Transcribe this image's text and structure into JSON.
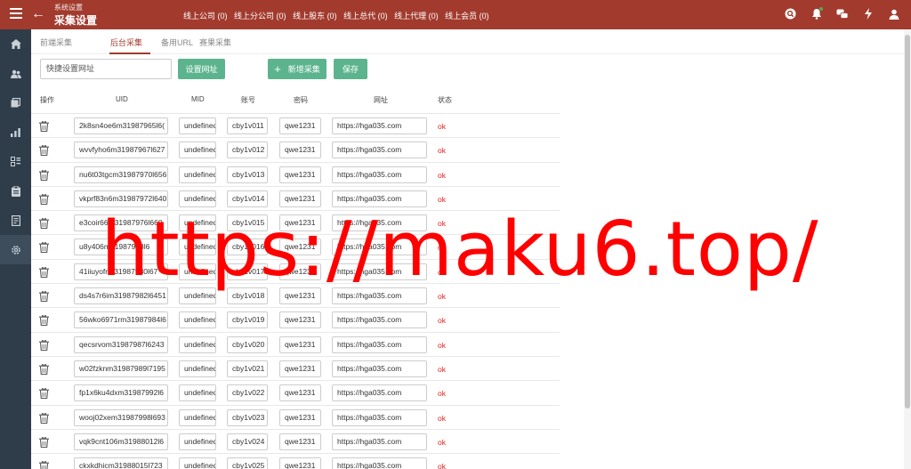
{
  "header": {
    "breadcrumb": "系统设置",
    "title": "采集设置",
    "back_glyph": "←",
    "stats": [
      "线上公司 (0)",
      "线上分公司 (0)",
      "线上股东 (0)",
      "线上总代 (0)",
      "线上代理 (0)",
      "线上会员 (0)"
    ]
  },
  "tabs": [
    "前端采集",
    "后台采集",
    "备用URL",
    "赛果采集"
  ],
  "toolbar": {
    "quick_input_placeholder": "快捷设置网址",
    "set_url_label": "设置网址",
    "add_label": "新增采集",
    "save_label": "保存"
  },
  "table": {
    "headers": [
      "操作",
      "UID",
      "MID",
      "账号",
      "密码",
      "网址",
      "状态"
    ],
    "rows": [
      {
        "uid": "2k8sn4oe6m31987965l6(",
        "mid": "undefined",
        "account": "cby1v011",
        "password": "qwe1231",
        "url": "https://hga035.com",
        "status": "ok"
      },
      {
        "uid": "wvvfyho6m31987967l627",
        "mid": "undefined",
        "account": "cby1v012",
        "password": "qwe1231",
        "url": "https://hga035.com",
        "status": "ok"
      },
      {
        "uid": "nu6t03tgcm31987970l656",
        "mid": "undefined",
        "account": "cby1v013",
        "password": "qwe1231",
        "url": "https://hga035.com",
        "status": "ok"
      },
      {
        "uid": "vkprf83n6m31987972l640",
        "mid": "undefined",
        "account": "cby1v014",
        "password": "qwe1231",
        "url": "https://hga035.com",
        "status": "ok"
      },
      {
        "uid": "e3coir66m31987976l660",
        "mid": "undefined",
        "account": "cby1v015",
        "password": "qwe1231",
        "url": "https://hga035.com",
        "status": "ok"
      },
      {
        "uid": "u8y406m31987978l6",
        "mid": "undefined",
        "account": "cby1v016",
        "password": "qwe1231",
        "url": "https://hga035.com",
        "status": "ok"
      },
      {
        "uid": "41iiuyofrm31987980l67",
        "mid": "undefined",
        "account": "cby1v017",
        "password": "qwe1231",
        "url": "https://hga035.com",
        "status": "ok"
      },
      {
        "uid": "ds4s7r6im31987982l6451",
        "mid": "undefined",
        "account": "cby1v018",
        "password": "qwe1231",
        "url": "https://hga035.com",
        "status": "ok"
      },
      {
        "uid": "56wko6971rm31987984l6",
        "mid": "undefined",
        "account": "cby1v019",
        "password": "qwe1231",
        "url": "https://hga035.com",
        "status": "ok"
      },
      {
        "uid": "qecsrvom31987987l6243",
        "mid": "undefined",
        "account": "cby1v020",
        "password": "qwe1231",
        "url": "https://hga035.com",
        "status": "ok"
      },
      {
        "uid": "w02fzknm31987989l7195",
        "mid": "undefined",
        "account": "cby1v021",
        "password": "qwe1231",
        "url": "https://hga035.com",
        "status": "ok"
      },
      {
        "uid": "fp1x6ku4dxm31987992l6",
        "mid": "undefined",
        "account": "cby1v022",
        "password": "qwe1231",
        "url": "https://hga035.com",
        "status": "ok"
      },
      {
        "uid": "wooj02xem31987998l693",
        "mid": "undefined",
        "account": "cby1v023",
        "password": "qwe1231",
        "url": "https://hga035.com",
        "status": "ok"
      },
      {
        "uid": "vqk9cnt106m31988012l6",
        "mid": "undefined",
        "account": "cby1v024",
        "password": "qwe1231",
        "url": "https://hga035.com",
        "status": "ok"
      },
      {
        "uid": "ckxkdhicm31988015l723",
        "mid": "undefined",
        "account": "cby1v025",
        "password": "qwe1231",
        "url": "https://hga035.com",
        "status": "ok"
      }
    ]
  },
  "watermark": "https://maku6.top/",
  "colors": {
    "header": "#a23b2e",
    "sidebar": "#2f3d4a",
    "button": "#5cb48e",
    "status_ok": "#e02020",
    "watermark": "#ff0000"
  },
  "icons": {
    "topbar": [
      "menu-icon",
      "back-arrow-icon",
      "search-icon",
      "bell-icon",
      "chat-icon",
      "bolt-icon",
      "user-icon"
    ],
    "sidebar": [
      "home-icon",
      "users-icon",
      "layers-icon",
      "chart-icon",
      "dashboard-icon",
      "clipboard-icon",
      "report-icon",
      "gear-icon"
    ],
    "row": "trash-icon"
  }
}
